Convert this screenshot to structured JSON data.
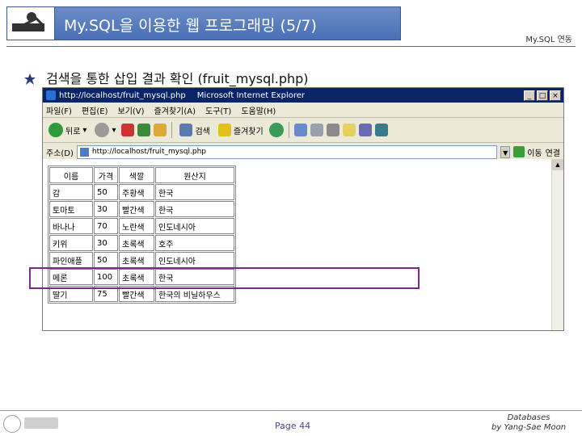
{
  "slide": {
    "title": "My.SQL을 이용한 웹 프로그래밍 (5/7)",
    "header_right": "My.SQL 연동",
    "bullet": "검색을 통한 삽입 결과 확인 (fruit_mysql.php)",
    "page": "Page 44",
    "credit_line1": "Databases",
    "credit_line2": "by Yang-Sae Moon",
    "highlight_color": "#7a2a8a",
    "title_bar_color": "#4a6fb5"
  },
  "browser": {
    "title_url": "http://localhost/fruit_mysql.php",
    "title_app": "Microsoft Internet Explorer",
    "window_buttons": [
      "_",
      "□",
      "×"
    ],
    "menu": [
      "파일(F)",
      "편집(E)",
      "보기(V)",
      "즐겨찾기(A)",
      "도구(T)",
      "도움말(H)"
    ],
    "toolbar": {
      "back": "뒤로",
      "search": "검색",
      "favorites": "즐겨찾기"
    },
    "address_label": "주소(D)",
    "address_value": "http://localhost/fruit_mysql.php",
    "go": "이동",
    "links": "연결"
  },
  "table": {
    "headers": [
      "이름",
      "가격",
      "색깔",
      "원산지"
    ],
    "rows": [
      [
        "감",
        "50",
        "주황색",
        "한국"
      ],
      [
        "토마토",
        "30",
        "빨간색",
        "한국"
      ],
      [
        "바나나",
        "70",
        "노란색",
        "인도네시아"
      ],
      [
        "키위",
        "30",
        "초록색",
        "호주"
      ],
      [
        "파인애플",
        "50",
        "초록색",
        "인도네시아"
      ],
      [
        "메론",
        "100",
        "초록색",
        "한국"
      ],
      [
        "딸기",
        "75",
        "빨간색",
        "한국의 비닐하우스"
      ]
    ]
  }
}
